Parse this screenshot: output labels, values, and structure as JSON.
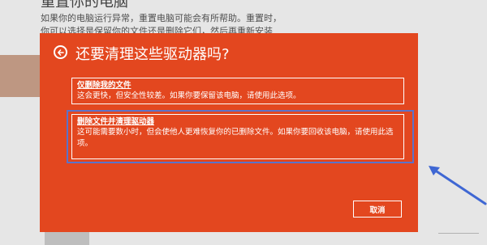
{
  "background": {
    "heading": "重置你的电脑",
    "text": "如果你的电脑运行异常，重置电脑可能会有所帮助。重置时，你可以选择是保留你的文件还是删除它们，然后再重新安装 Windows。"
  },
  "dialog": {
    "title": "还要清理这些驱动器吗?",
    "back_icon": "back-arrow-icon",
    "options": [
      {
        "title": "仅删除我的文件",
        "desc": "这会更快，但安全性较差。如果你要保留该电脑，请使用此选项。"
      },
      {
        "title": "删除文件并清理驱动器",
        "desc": "这可能需要数小时，但会使他人更难恢复你的已删除文件。如果你要回收该电脑，请使用此选项。"
      }
    ],
    "cancel_label": "取消"
  },
  "colors": {
    "dialog_bg": "#e3471f",
    "highlight": "#5b73c9",
    "arrow": "#3f67d3"
  }
}
